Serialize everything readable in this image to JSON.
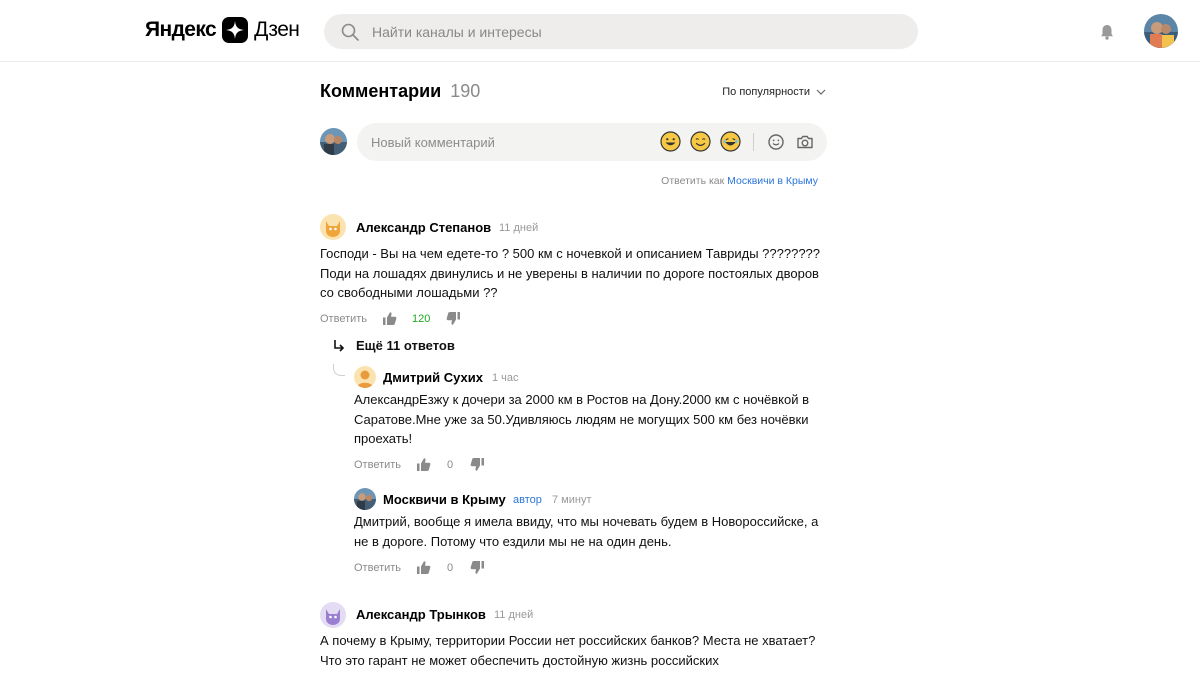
{
  "header": {
    "logo_left": "Яндекс",
    "logo_right": "Дзен",
    "search_placeholder": "Найти каналы и интересы"
  },
  "comments_section": {
    "title": "Комментарии",
    "count": "190",
    "sort_label": "По популярности",
    "new_comment_placeholder": "Новый комментарий",
    "reply_as_prefix": "Ответить как",
    "reply_as_name": "Москвичи в Крыму"
  },
  "comments": [
    {
      "author": "Александр Степанов",
      "time": "11 дней",
      "text": "Господи - Вы на чем едете-то ? 500 км с ночевкой и описанием Тавриды ???????? Поди на лошадях двинулись и не уверены в наличии по дороге постоялых дворов со свободными лошадьми ??",
      "reply_label": "Ответить",
      "likes": "120",
      "more_replies": "Ещё 11 ответов",
      "replies": [
        {
          "author": "Дмитрий Сухих",
          "time": "1 час",
          "text": "АлександрЕзжу к дочери за 2000 км в Ростов на Дону.2000 км с ночёвкой в Саратове.Мне уже за 50.Удивляюсь людям не могущих 500 км без ночёвки проехать!",
          "reply_label": "Ответить",
          "likes": "0"
        },
        {
          "author": "Москвичи в Крыму",
          "badge": "автор",
          "time": "7 минут",
          "text": "Дмитрий, вообще я имела ввиду, что мы ночевать будем в Новороссийске, а не в дороге. Потому что ездили мы не на один день.",
          "reply_label": "Ответить",
          "likes": "0"
        }
      ]
    },
    {
      "author": "Александр Трынков",
      "time": "11 дней",
      "text": "А почему в Крыму, территории России нет российских банков? Места не хватает? Что это гарант не может обеспечить достойную жизнь российских"
    }
  ],
  "colors": {
    "link_blue": "#2b76d9",
    "likes_green": "#1ea81e",
    "muted_gray": "#8a8a8a",
    "search_bg": "#eeedeb"
  }
}
